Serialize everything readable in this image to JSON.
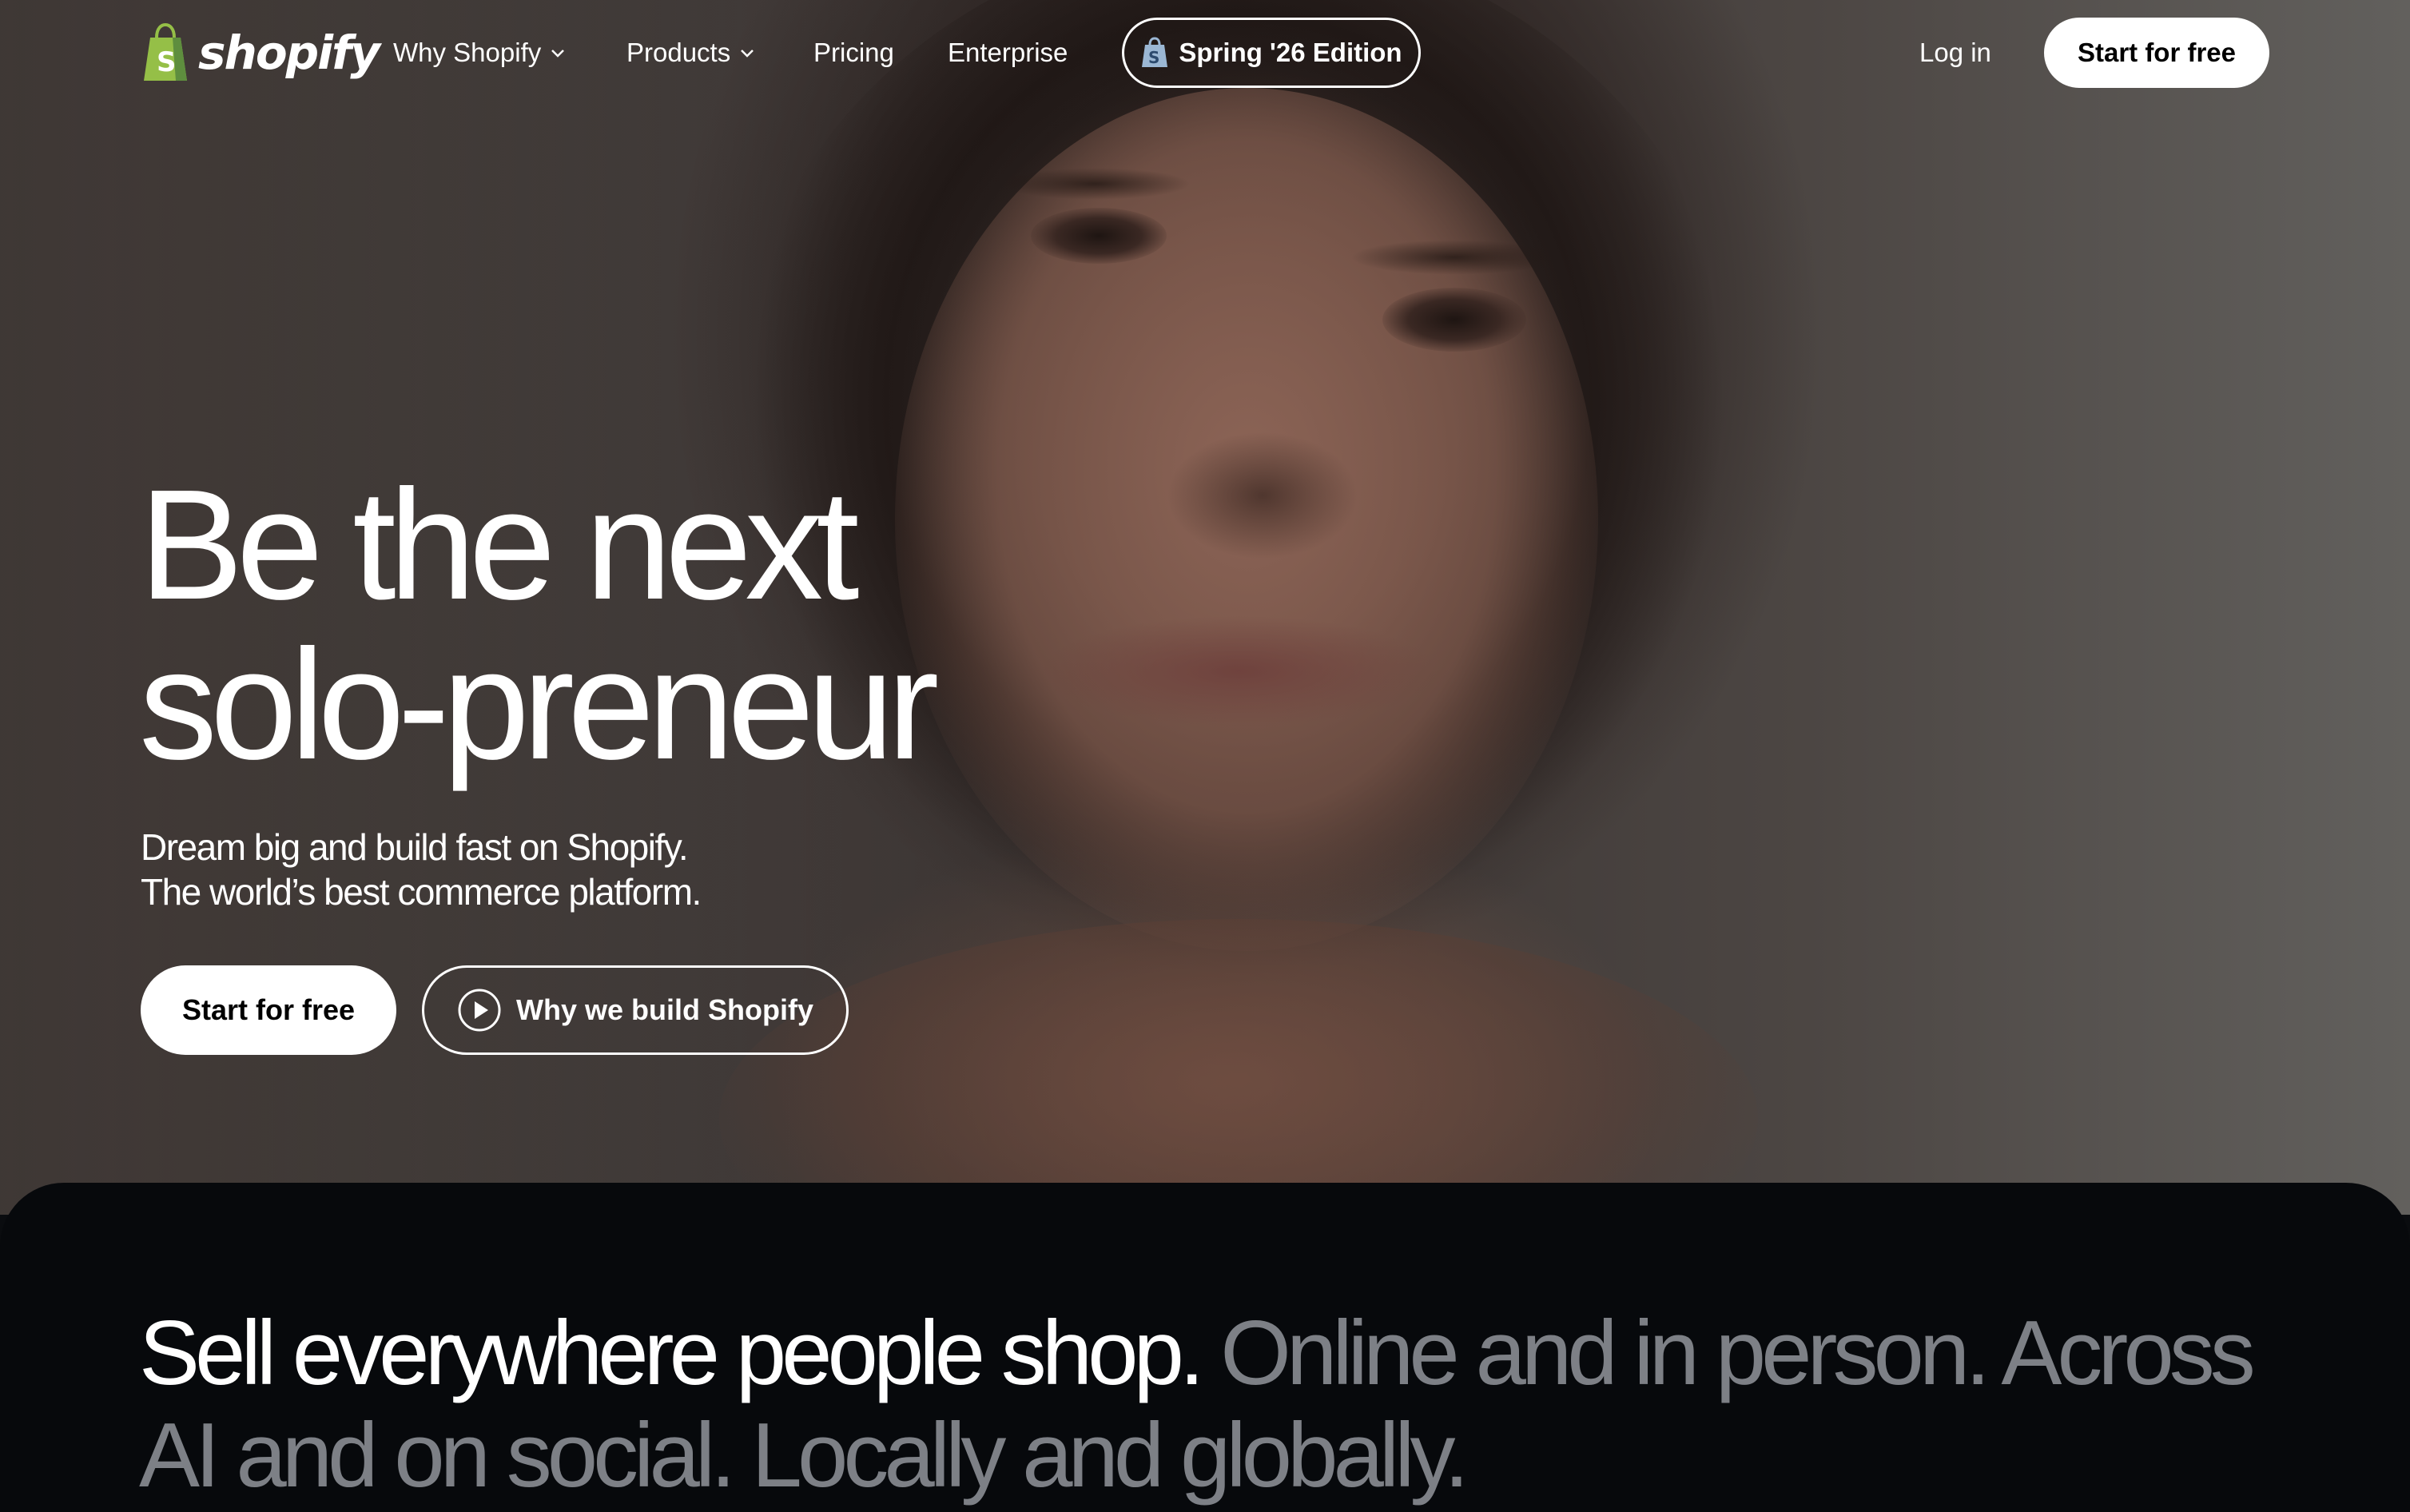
{
  "nav": {
    "logo_text": "shopify",
    "items": [
      {
        "label": "Why Shopify",
        "has_dropdown": true
      },
      {
        "label": "Products",
        "has_dropdown": true
      },
      {
        "label": "Pricing",
        "has_dropdown": false
      },
      {
        "label": "Enterprise",
        "has_dropdown": false
      }
    ],
    "edition_label": "Spring '26 Edition",
    "login_label": "Log in",
    "cta_label": "Start for free"
  },
  "hero": {
    "headline_line1": "Be the next",
    "headline_line2": "solo-preneur",
    "subhead_line1": "Dream big and build fast on Shopify.",
    "subhead_line2": "The world’s best commerce platform.",
    "cta_label": "Start for free",
    "video_label": "Why we build Shopify"
  },
  "section": {
    "lead": "Sell everywhere people shop.",
    "rest": " Online and in person. Across AI and on social. Locally and globally."
  },
  "colors": {
    "brand_green": "#95bf47",
    "dark_bg": "#07090c",
    "muted_text": "#7d8086"
  },
  "icons": [
    "shopify-bag-icon",
    "chevron-down-icon",
    "edition-bag-icon",
    "play-icon"
  ]
}
